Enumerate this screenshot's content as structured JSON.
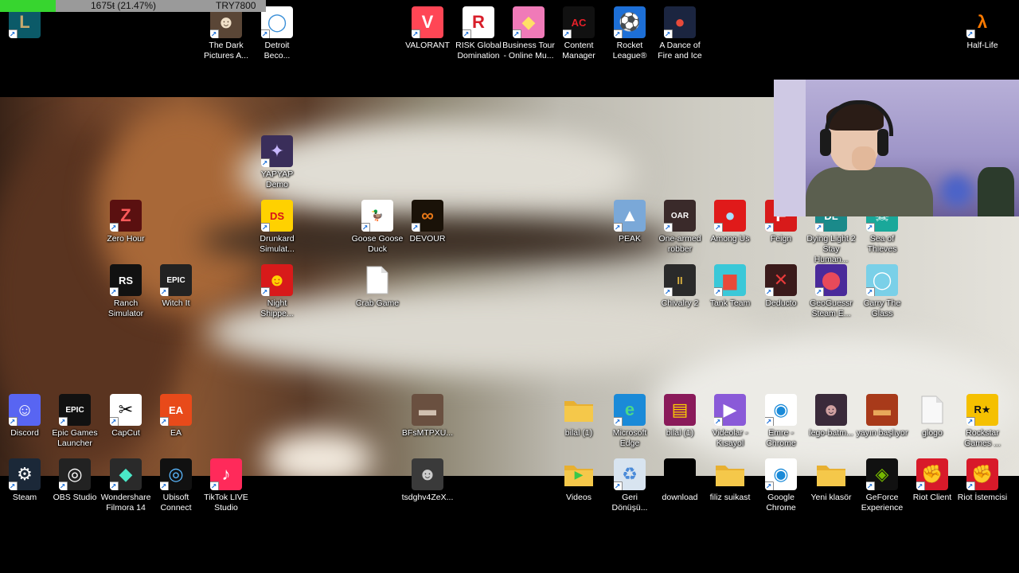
{
  "progress": {
    "fraction": 0.2147,
    "text": "1675ŧ (21.47%)",
    "code": "TRY7800"
  },
  "webcam": {
    "present": true
  },
  "desktop_icons": [
    {
      "key": "lol",
      "label": "",
      "color": "#0b5a68",
      "glyph": "L",
      "glyph_color": "#c8aa6e"
    },
    {
      "key": "dark-pictures",
      "label": "The Dark\nPictures A...",
      "color": "#5a4636",
      "glyph": "☻",
      "glyph_color": "#f0e0c8"
    },
    {
      "key": "detroit",
      "label": "Detroit\nBeco...",
      "color": "#ffffff",
      "glyph": "◯",
      "glyph_color": "#3a8fd8"
    },
    {
      "key": "valorant",
      "label": "VALORANT",
      "color": "#ff4655",
      "glyph": "V",
      "glyph_color": "#ffffff"
    },
    {
      "key": "risk",
      "label": "RISK Global\nDomination",
      "color": "#ffffff",
      "glyph": "R",
      "glyph_color": "#d81e2a"
    },
    {
      "key": "business-tour",
      "label": "Business Tour\n- Online Mu...",
      "color": "#f07ab8",
      "glyph": "◆",
      "glyph_color": "#ffe066"
    },
    {
      "key": "content-manager",
      "label": "Content\nManager",
      "color": "#111111",
      "glyph": "AC",
      "glyph_color": "#e8202a"
    },
    {
      "key": "rocket-league",
      "label": "Rocket\nLeague®",
      "color": "#1d6fd6",
      "glyph": "⚽",
      "glyph_color": "#ffffff"
    },
    {
      "key": "dance-fire-ice",
      "label": "A Dance of\nFire and Ice",
      "color": "#1b2540",
      "glyph": "●",
      "glyph_color": "#e84a3a"
    },
    {
      "key": "half-life",
      "label": "Half-Life",
      "color": "#000000",
      "glyph": "λ",
      "glyph_color": "#ff7a00"
    },
    {
      "key": "yapyap",
      "label": "YAPYAP\nDemo",
      "color": "#3a2e5a",
      "glyph": "✦",
      "glyph_color": "#c8b8ff"
    },
    {
      "key": "zero-hour",
      "label": "Zero Hour",
      "color": "#5a1010",
      "glyph": "Z",
      "glyph_color": "#ff5a5a"
    },
    {
      "key": "drunkard",
      "label": "Drunkard\nSimulat...",
      "color": "#ffd100",
      "glyph": "DS",
      "glyph_color": "#d8121a"
    },
    {
      "key": "goose",
      "label": "Goose Goose\nDuck",
      "color": "#ffffff",
      "glyph": "🦆",
      "glyph_color": "#f0a020"
    },
    {
      "key": "devour",
      "label": "DEVOUR",
      "color": "#1a1208",
      "glyph": "∞",
      "glyph_color": "#e87818"
    },
    {
      "key": "peak",
      "label": "PEAK",
      "color": "#7aa8d8",
      "glyph": "▲",
      "glyph_color": "#ffffff"
    },
    {
      "key": "one-armed-robber",
      "label": "One-armed\nrobber",
      "color": "#3a2a2a",
      "glyph": "OAR",
      "glyph_color": "#ffffff"
    },
    {
      "key": "among-us",
      "label": "Among Us",
      "color": "#e01a1a",
      "glyph": "●",
      "glyph_color": "#a8e0ff"
    },
    {
      "key": "feign",
      "label": "Feign",
      "color": "#d81a1a",
      "glyph": "F",
      "glyph_color": "#ffffff"
    },
    {
      "key": "dying-light",
      "label": "Dying Light 2\nStay Human...",
      "color": "#1a8a8a",
      "glyph": "DL",
      "glyph_color": "#ffffff"
    },
    {
      "key": "sea-of-thieves",
      "label": "Sea of\nThieves",
      "color": "#1aa89a",
      "glyph": "☠",
      "glyph_color": "#ffffff"
    },
    {
      "key": "ranch",
      "label": "Ranch\nSimulator",
      "color": "#111111",
      "glyph": "RS",
      "glyph_color": "#ffffff"
    },
    {
      "key": "witch-it",
      "label": "Witch It",
      "color": "#222222",
      "glyph": "EPIC",
      "glyph_color": "#ffffff"
    },
    {
      "key": "night-shipper",
      "label": "Night\nShippe...",
      "color": "#d81a1a",
      "glyph": "☻",
      "glyph_color": "#ffd100"
    },
    {
      "key": "crab-game",
      "label": "Crab Game",
      "color": "#ffffff",
      "glyph": "",
      "glyph_color": "#cccccc"
    },
    {
      "key": "chivalry",
      "label": "Chivalry 2",
      "color": "#2a2a2a",
      "glyph": "II",
      "glyph_color": "#d8b040"
    },
    {
      "key": "tank-team",
      "label": "Tank Team",
      "color": "#3ac8d8",
      "glyph": "▆",
      "glyph_color": "#e84a3a"
    },
    {
      "key": "deducto",
      "label": "Deducto",
      "color": "#3a1a1a",
      "glyph": "✕",
      "glyph_color": "#e83a3a"
    },
    {
      "key": "geoguessr",
      "label": "GeoGuessr\nSteam E...",
      "color": "#4a2a9a",
      "glyph": "⬤",
      "glyph_color": "#e84a5a"
    },
    {
      "key": "carry-glass",
      "label": "Carry The\nGlass",
      "color": "#7ad0e8",
      "glyph": "◯",
      "glyph_color": "#ffffff"
    },
    {
      "key": "discord",
      "label": "Discord",
      "color": "#5865f2",
      "glyph": "☺",
      "glyph_color": "#ffffff"
    },
    {
      "key": "epic-games",
      "label": "Epic Games\nLauncher",
      "color": "#111111",
      "glyph": "EPIC",
      "glyph_color": "#ffffff"
    },
    {
      "key": "capcut",
      "label": "CapCut",
      "color": "#ffffff",
      "glyph": "✂",
      "glyph_color": "#000000"
    },
    {
      "key": "ea",
      "label": "EA",
      "color": "#e84a1a",
      "glyph": "EA",
      "glyph_color": "#ffffff"
    },
    {
      "key": "bfsmtpxu",
      "label": "BFsMTPXU...",
      "color": "#6a5040",
      "glyph": "▬",
      "glyph_color": "#d0c0b0"
    },
    {
      "key": "bilal-1",
      "label": "bilal (1)",
      "color": "#f5c84a",
      "glyph": "",
      "glyph_color": "#f5c84a"
    },
    {
      "key": "edge",
      "label": "Microsoft\nEdge",
      "color": "#1a8ad8",
      "glyph": "e",
      "glyph_color": "#4ad88a"
    },
    {
      "key": "bilal-rar",
      "label": "bilal (1)",
      "color": "#8a1a5a",
      "glyph": "▤",
      "glyph_color": "#ffd100"
    },
    {
      "key": "videolar",
      "label": "Videolar -\nKısayol",
      "color": "#8a5ad8",
      "glyph": "▶",
      "glyph_color": "#ffffff"
    },
    {
      "key": "emre-chrome",
      "label": "Emre -\nChrome",
      "color": "#ffffff",
      "glyph": "◉",
      "glyph_color": "#1a8ad8"
    },
    {
      "key": "lego-batman",
      "label": "lego-batm...",
      "color": "#3a2a3a",
      "glyph": "☻",
      "glyph_color": "#d0a0a0"
    },
    {
      "key": "yayin-basliyor",
      "label": "yayın başlıyor",
      "color": "#a83a1a",
      "glyph": "▬",
      "glyph_color": "#e8a85a"
    },
    {
      "key": "glogo",
      "label": "glogo",
      "color": "#f8f8f8",
      "glyph": "",
      "glyph_color": "#cccccc"
    },
    {
      "key": "rockstar",
      "label": "Rockstar\nGames ...",
      "color": "#f5c000",
      "glyph": "R★",
      "glyph_color": "#111111"
    },
    {
      "key": "steam",
      "label": "Steam",
      "color": "#1b2838",
      "glyph": "⚙",
      "glyph_color": "#ffffff"
    },
    {
      "key": "obs",
      "label": "OBS Studio",
      "color": "#222222",
      "glyph": "◎",
      "glyph_color": "#ffffff"
    },
    {
      "key": "filmora",
      "label": "Wondershare\nFilmora 14",
      "color": "#2a2a2a",
      "glyph": "◆",
      "glyph_color": "#4ae8c8"
    },
    {
      "key": "ubisoft",
      "label": "Ubisoft\nConnect",
      "color": "#111111",
      "glyph": "◎",
      "glyph_color": "#5ab8ff"
    },
    {
      "key": "tiktok-live",
      "label": "TikTok LIVE\nStudio",
      "color": "#ff2a5a",
      "glyph": "♪",
      "glyph_color": "#ffffff"
    },
    {
      "key": "tsdghv",
      "label": "tsdghv4ZeX...",
      "color": "#3a3a3a",
      "glyph": "☻",
      "glyph_color": "#cccccc"
    },
    {
      "key": "videos",
      "label": "Videos",
      "color": "#f5c84a",
      "glyph": "▶",
      "glyph_color": "#3ac84a"
    },
    {
      "key": "recycle-bin",
      "label": "Geri\nDönüşü...",
      "color": "#d8e4f0",
      "glyph": "♻",
      "glyph_color": "#4a8ad8"
    },
    {
      "key": "download",
      "label": "download",
      "color": "#000000",
      "glyph": "",
      "glyph_color": "#000000"
    },
    {
      "key": "filiz-suikast",
      "label": "filiz suikast",
      "color": "#f5c84a",
      "glyph": "",
      "glyph_color": "#f5c84a"
    },
    {
      "key": "google-chrome",
      "label": "Google\nChrome",
      "color": "#ffffff",
      "glyph": "◉",
      "glyph_color": "#1a8ad8"
    },
    {
      "key": "yeni-klasor",
      "label": "Yeni klasör",
      "color": "#f5c84a",
      "glyph": "",
      "glyph_color": "#f5c84a"
    },
    {
      "key": "geforce",
      "label": "GeForce\nExperience",
      "color": "#111111",
      "glyph": "◈",
      "glyph_color": "#76b900"
    },
    {
      "key": "riot-client",
      "label": "Riot Client",
      "color": "#d81a2a",
      "glyph": "✊",
      "glyph_color": "#ffffff"
    },
    {
      "key": "riot-istemcisi",
      "label": "Riot İstemcisi",
      "color": "#d81a2a",
      "glyph": "✊",
      "glyph_color": "#ffffff"
    }
  ]
}
